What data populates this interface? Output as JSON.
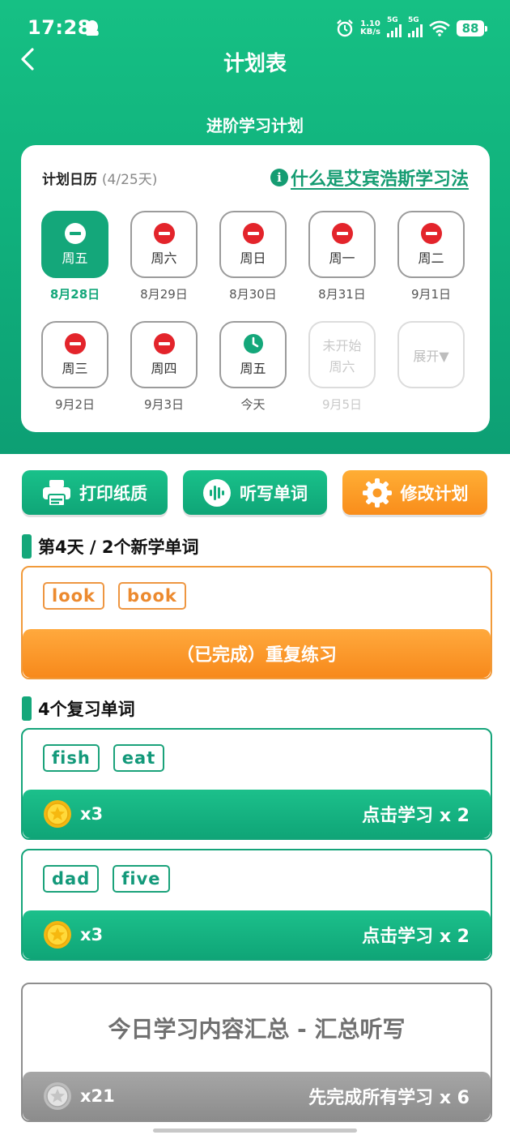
{
  "status_bar": {
    "time": "17:28",
    "net_speed_top": "1.10",
    "net_speed_bottom": "KB/s",
    "sig1": "5G",
    "sig2": "5G",
    "battery": "88"
  },
  "nav": {
    "title": "计划表"
  },
  "plan": {
    "subtitle": "进阶学习计划"
  },
  "calendar": {
    "label": "计划日历",
    "progress": "(4/25天)",
    "help_link": "什么是艾宾浩斯学习法",
    "days": [
      {
        "weekday": "周五",
        "date": "8月28日",
        "icon": "minus-circle-icon"
      },
      {
        "weekday": "周六",
        "date": "8月29日",
        "icon": "minus-circle-icon"
      },
      {
        "weekday": "周日",
        "date": "8月30日",
        "icon": "minus-circle-icon"
      },
      {
        "weekday": "周一",
        "date": "8月31日",
        "icon": "minus-circle-icon"
      },
      {
        "weekday": "周二",
        "date": "9月1日",
        "icon": "minus-circle-icon"
      },
      {
        "weekday": "周三",
        "date": "9月2日",
        "icon": "minus-circle-icon"
      },
      {
        "weekday": "周四",
        "date": "9月3日",
        "icon": "minus-circle-icon"
      },
      {
        "weekday": "周五",
        "date": "今天",
        "icon": "clock-icon"
      },
      {
        "weekday": "周六",
        "date": "9月5日",
        "status": "未开始"
      },
      {
        "expand": "展开▼"
      }
    ]
  },
  "actions": {
    "print": "打印纸质",
    "dictation": "听写单词",
    "modify": "修改计划"
  },
  "new_words": {
    "title": "第4天 / 2个新学单词",
    "words": [
      "look",
      "book"
    ],
    "button": "（已完成）重复练习"
  },
  "review": {
    "title": "4个复习单词",
    "groups": [
      {
        "words": [
          "fish",
          "eat"
        ],
        "coins": "x3",
        "action": "点击学习 x 2"
      },
      {
        "words": [
          "dad",
          "five"
        ],
        "coins": "x3",
        "action": "点击学习 x 2"
      }
    ]
  },
  "summary": {
    "title": "今日学习内容汇总 - 汇总听写",
    "coins": "x21",
    "action": "先完成所有学习 x 6"
  },
  "colors": {
    "primary_green": "#14a77a",
    "orange": "#f98d1b",
    "red": "#e3242b",
    "gray": "#8c8c8c"
  }
}
